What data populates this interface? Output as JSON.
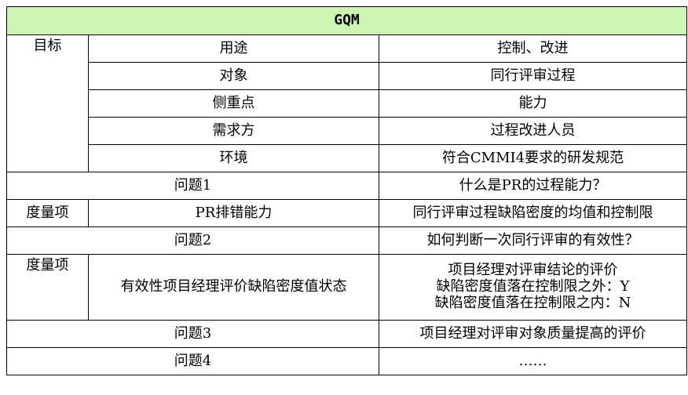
{
  "title": "GQM",
  "goal": {
    "label": "目标",
    "rows": [
      {
        "key": "用途",
        "value": "控制、改进"
      },
      {
        "key": "对象",
        "value": "同行评审过程"
      },
      {
        "key": "侧重点",
        "value": "能力"
      },
      {
        "key": "需求方",
        "value": "过程改进人员"
      },
      {
        "key": "环境",
        "value": "符合CMMI4要求的研发规范"
      }
    ]
  },
  "q1": {
    "label": "问题1",
    "text": "什么是PR的过程能力？"
  },
  "m1": {
    "label": "度量项",
    "name": "PR排错能力",
    "desc": "同行评审过程缺陷密度的均值和控制限"
  },
  "q2": {
    "label": "问题2",
    "text": "如何判断一次同行评审的有效性？"
  },
  "m2": {
    "label": "度量项",
    "name": "有效性项目经理评价缺陷密度值状态",
    "desc_lines": [
      "项目经理对评审结论的评价",
      "缺陷密度值落在控制限之外：Y",
      "缺陷密度值落在控制限之内：N"
    ]
  },
  "q3": {
    "label": "问题3",
    "text": "项目经理对评审对象质量提高的评价"
  },
  "q4": {
    "label": "问题4",
    "text": "……"
  }
}
